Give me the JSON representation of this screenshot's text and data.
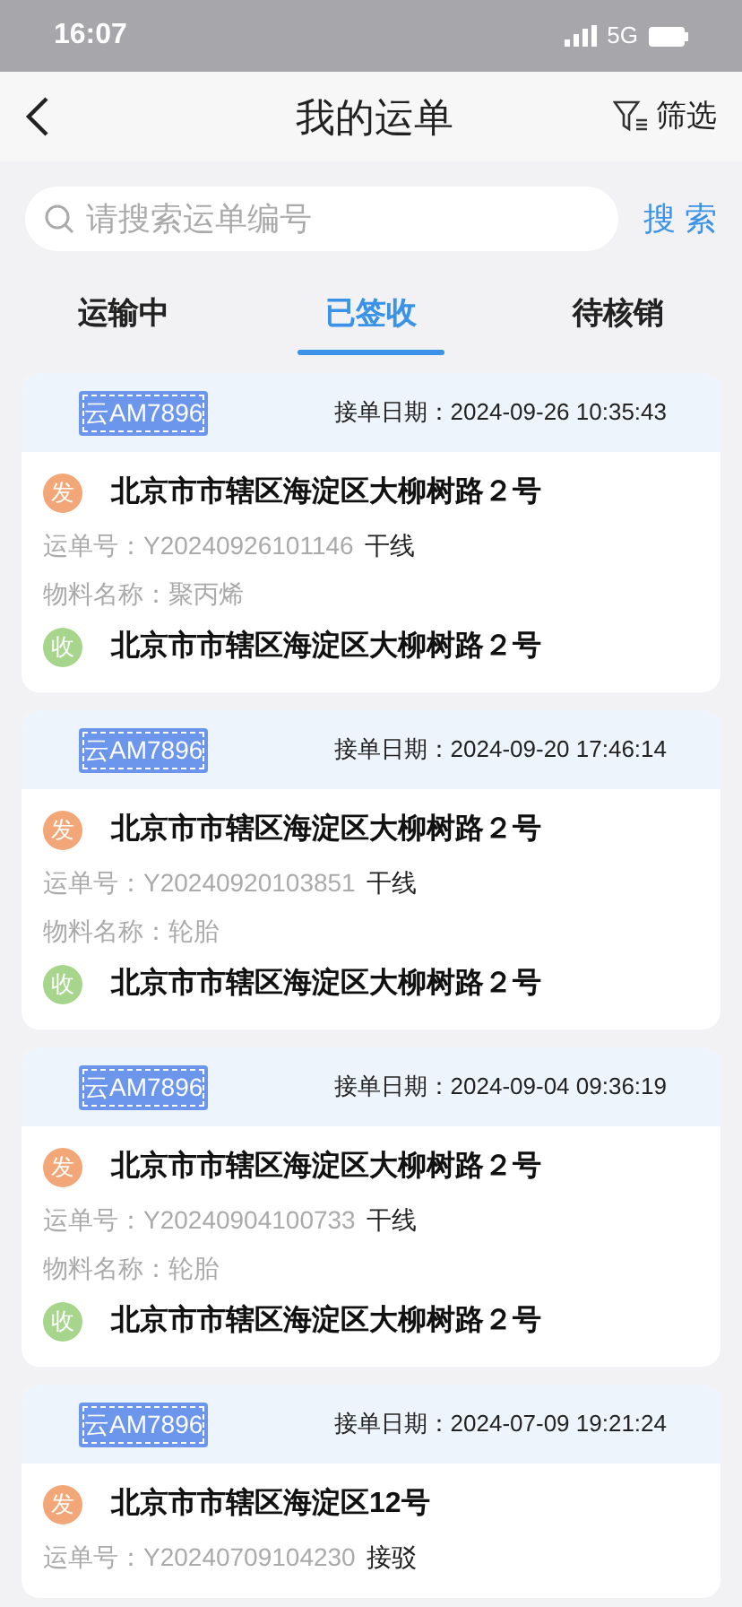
{
  "status_bar": {
    "time": "16:07",
    "network": "5G"
  },
  "nav": {
    "title": "我的运单",
    "filter": "筛选"
  },
  "search": {
    "placeholder": "请搜索运单编号",
    "button": "搜 索"
  },
  "tabs": [
    {
      "label": "运输中",
      "selected": false
    },
    {
      "label": "已签收",
      "selected": true
    },
    {
      "label": "待核销",
      "selected": false
    }
  ],
  "orders": [
    {
      "plate": "云AM7896",
      "date_label": "接单日期：",
      "date": "2024-09-26 10:35:43",
      "from_mark": "发",
      "from": "北京市市辖区海淀区大柳树路２号",
      "waybill_label": "运单号：",
      "waybill": "Y20240926101146",
      "type": "干线",
      "material_label": "物料名称：",
      "material": "聚丙烯",
      "to_mark": "收",
      "to": "北京市市辖区海淀区大柳树路２号"
    },
    {
      "plate": "云AM7896",
      "date_label": "接单日期：",
      "date": "2024-09-20 17:46:14",
      "from_mark": "发",
      "from": "北京市市辖区海淀区大柳树路２号",
      "waybill_label": "运单号：",
      "waybill": "Y20240920103851",
      "type": "干线",
      "material_label": "物料名称：",
      "material": "轮胎",
      "to_mark": "收",
      "to": "北京市市辖区海淀区大柳树路２号"
    },
    {
      "plate": "云AM7896",
      "date_label": "接单日期：",
      "date": "2024-09-04 09:36:19",
      "from_mark": "发",
      "from": "北京市市辖区海淀区大柳树路２号",
      "waybill_label": "运单号：",
      "waybill": "Y20240904100733",
      "type": "干线",
      "material_label": "物料名称：",
      "material": "轮胎",
      "to_mark": "收",
      "to": "北京市市辖区海淀区大柳树路２号"
    },
    {
      "plate": "云AM7896",
      "date_label": "接单日期：",
      "date": "2024-07-09 19:21:24",
      "from_mark": "发",
      "from": "北京市市辖区海淀区12号",
      "waybill_label": "运单号：",
      "waybill": "Y20240709104230",
      "type": "接驳"
    }
  ]
}
